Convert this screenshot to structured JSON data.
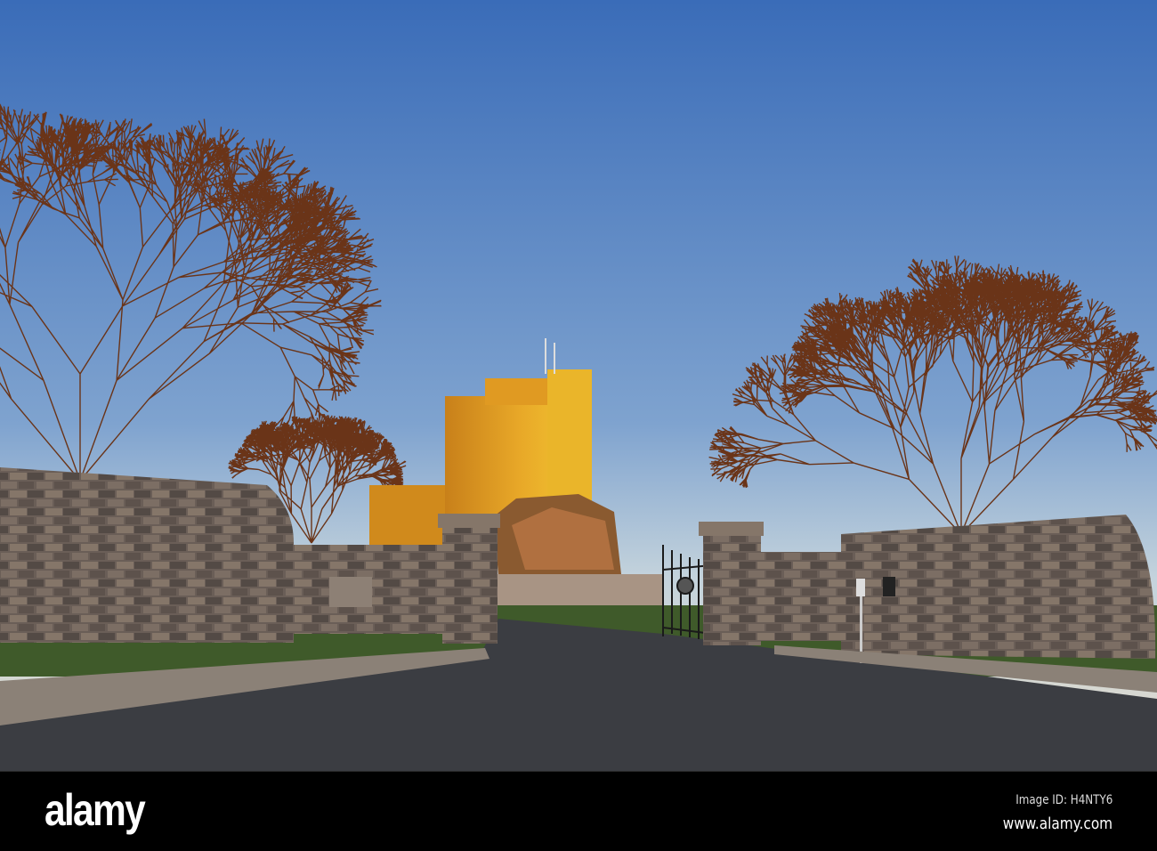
{
  "watermark": {
    "brand": "alamy",
    "image_id": "Image ID: H4NTY6",
    "url": "www.alamy.com"
  },
  "colors": {
    "sky_top": "#3a6cb8",
    "sky_bottom": "#cfdadc",
    "castle": "#e0a020",
    "stone": "#6d6058",
    "road": "#3b3d42",
    "grass": "#3f5a2a"
  }
}
